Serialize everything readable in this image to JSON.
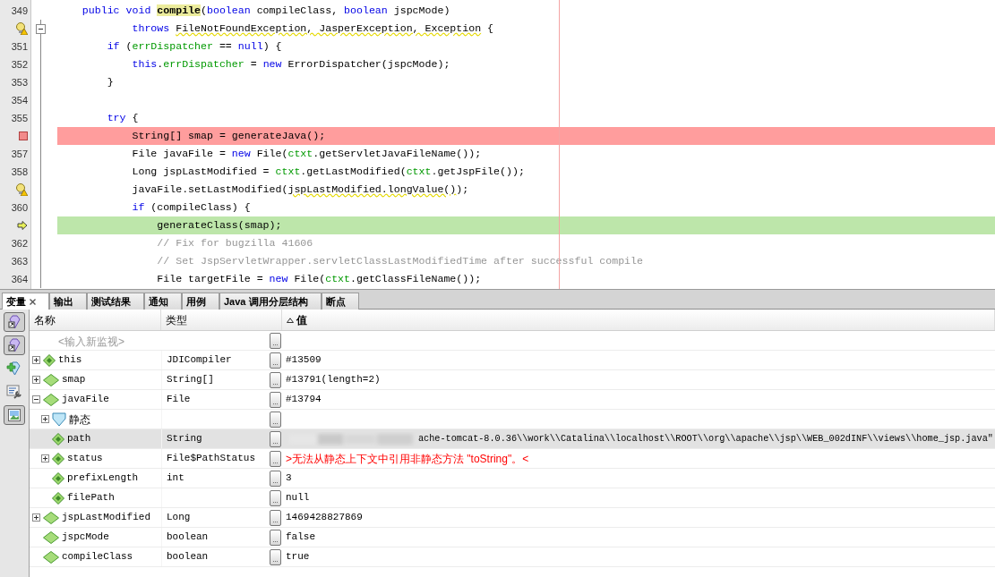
{
  "editor": {
    "lines": [
      {
        "number": "349",
        "kind": "plain",
        "fold": false,
        "tokens": [
          {
            "kind": "keyword",
            "text": "    public void "
          },
          {
            "kind": "match",
            "text": "compile"
          },
          {
            "kind": "plain",
            "text": "("
          },
          {
            "kind": "keyword",
            "text": "boolean"
          },
          {
            "kind": "plain",
            "text": " compileClass, "
          },
          {
            "kind": "keyword",
            "text": "boolean"
          },
          {
            "kind": "plain",
            "text": " jspcMode)"
          }
        ]
      },
      {
        "kind": "warning",
        "fold": true,
        "tokens": [
          {
            "kind": "keyword",
            "text": "            throws "
          },
          {
            "kind": "warn",
            "text": "FileNotFoundException, JasperException, Exception"
          },
          {
            "kind": "plain",
            "text": " {"
          }
        ]
      },
      {
        "number": "351",
        "kind": "plain",
        "fold": false,
        "tokens": [
          {
            "kind": "keyword",
            "text": "        if"
          },
          {
            "kind": "plain",
            "text": " ("
          },
          {
            "kind": "field",
            "text": "errDispatcher"
          },
          {
            "kind": "plain",
            "text": " == "
          },
          {
            "kind": "keyword",
            "text": "null"
          },
          {
            "kind": "plain",
            "text": ") {"
          }
        ]
      },
      {
        "number": "352",
        "kind": "plain",
        "fold": false,
        "tokens": [
          {
            "kind": "keyword",
            "text": "            this"
          },
          {
            "kind": "plain",
            "text": "."
          },
          {
            "kind": "field",
            "text": "errDispatcher"
          },
          {
            "kind": "plain",
            "text": " = "
          },
          {
            "kind": "keyword",
            "text": "new"
          },
          {
            "kind": "plain",
            "text": " ErrorDispatcher(jspcMode);"
          }
        ]
      },
      {
        "number": "353",
        "kind": "plain",
        "fold": false,
        "tokens": [
          {
            "kind": "plain",
            "text": "        }"
          }
        ]
      },
      {
        "number": "354",
        "kind": "plain",
        "fold": false
      },
      {
        "number": "355",
        "kind": "plain",
        "fold": false,
        "tokens": [
          {
            "kind": "keyword",
            "text": "        try"
          },
          {
            "kind": "plain",
            "text": " {"
          }
        ]
      },
      {
        "kind": "breakpoint",
        "fold": false,
        "tokens": [
          {
            "kind": "plain",
            "text": "            String[] smap = generateJava();"
          }
        ]
      },
      {
        "number": "357",
        "kind": "plain",
        "fold": false,
        "tokens": [
          {
            "kind": "plain",
            "text": "            File javaFile = "
          },
          {
            "kind": "keyword",
            "text": "new"
          },
          {
            "kind": "plain",
            "text": " File("
          },
          {
            "kind": "field",
            "text": "ctxt"
          },
          {
            "kind": "plain",
            "text": ".getServletJavaFileName());"
          }
        ]
      },
      {
        "number": "358",
        "kind": "plain",
        "fold": false,
        "tokens": [
          {
            "kind": "plain",
            "text": "            Long jspLastModified = "
          },
          {
            "kind": "field",
            "text": "ctxt"
          },
          {
            "kind": "plain",
            "text": ".getLastModified("
          },
          {
            "kind": "field",
            "text": "ctxt"
          },
          {
            "kind": "plain",
            "text": ".getJspFile());"
          }
        ]
      },
      {
        "kind": "warning",
        "fold": false,
        "tokens": [
          {
            "kind": "plain",
            "text": "            javaFile.setLastModified("
          },
          {
            "kind": "warn",
            "text": "jspLastModified.longValue()"
          },
          {
            "kind": "plain",
            "text": ");"
          }
        ]
      },
      {
        "number": "360",
        "kind": "plain",
        "fold": false,
        "tokens": [
          {
            "kind": "keyword",
            "text": "            if"
          },
          {
            "kind": "plain",
            "text": " (compileClass) {"
          }
        ]
      },
      {
        "kind": "current",
        "fold": false,
        "tokens": [
          {
            "kind": "plain",
            "text": "                generateClass(smap);"
          }
        ]
      },
      {
        "number": "362",
        "kind": "plain",
        "fold": false,
        "tokens": [
          {
            "kind": "comment",
            "text": "                // Fix for bugzilla 41606"
          }
        ]
      },
      {
        "number": "363",
        "kind": "plain",
        "fold": false,
        "tokens": [
          {
            "kind": "comment",
            "text": "                // Set JspServletWrapper.servletClassLastModifiedTime after successful compile"
          }
        ]
      },
      {
        "number": "364",
        "kind": "plain",
        "fold": false,
        "tokens": [
          {
            "kind": "plain",
            "text": "                File targetFile = "
          },
          {
            "kind": "keyword",
            "text": "new"
          },
          {
            "kind": "plain",
            "text": " File("
          },
          {
            "kind": "field",
            "text": "ctxt"
          },
          {
            "kind": "plain",
            "text": ".getClassFileName());"
          }
        ]
      }
    ]
  },
  "tabs": [
    {
      "label": "变量",
      "selected": true,
      "closable": true
    },
    {
      "label": "输出",
      "selected": false,
      "closable": false
    },
    {
      "label": "测试结果",
      "selected": false,
      "closable": false
    },
    {
      "label": "通知",
      "selected": false,
      "closable": false
    },
    {
      "label": "用例",
      "selected": false,
      "closable": false
    },
    {
      "label": "Java 调用分层结构",
      "selected": false,
      "closable": false
    },
    {
      "label": "断点",
      "selected": false,
      "closable": false
    }
  ],
  "toolbar": [
    {
      "kind": "gem-arrow",
      "pressed": true
    },
    {
      "kind": "gem-arrow",
      "pressed": true
    },
    {
      "kind": "gem-add",
      "pressed": false
    },
    {
      "kind": "wrench",
      "pressed": false
    },
    {
      "kind": "image",
      "pressed": true
    }
  ],
  "table": {
    "columns": [
      {
        "label": "名称",
        "sorted": false
      },
      {
        "label": "类型",
        "sorted": false
      },
      {
        "label": "值",
        "sorted": true
      }
    ],
    "new_watch": {
      "placeholder": "<输入新监视>",
      "edit_button": "..."
    },
    "rows": [
      {
        "name": "this",
        "kind": "field",
        "type": "JDICompiler",
        "value": "#13509",
        "expandable": true,
        "expanded": false,
        "selected": false,
        "error": false,
        "blurred": false,
        "edit_button": "..."
      },
      {
        "name": "smap",
        "kind": "local",
        "type": "String[]",
        "value": "#13791(length=2)",
        "expandable": true,
        "expanded": false,
        "selected": false,
        "error": false,
        "blurred": false,
        "edit_button": "..."
      },
      {
        "name": "javaFile",
        "kind": "local",
        "type": "File",
        "value": "#13794",
        "expandable": true,
        "expanded": true,
        "selected": false,
        "error": false,
        "blurred": false,
        "edit_button": "...",
        "children": [
          {
            "name": "静态",
            "kind": "static",
            "expandable": true,
            "expanded": false,
            "selected": false,
            "edit_button": "..."
          },
          {
            "name": "path",
            "kind": "field",
            "type": "String",
            "value": "ache-tomcat-8.0.36\\\\work\\\\Catalina\\\\localhost\\\\ROOT\\\\org\\\\apache\\\\jsp\\\\WEB_002dINF\\\\views\\\\home_jsp.java\"",
            "expandable": false,
            "selected": true,
            "error": false,
            "blurred": true,
            "edit_button": "..."
          },
          {
            "name": "status",
            "kind": "field",
            "type": "File$PathStatus",
            "value": ">无法从静态上下文中引用非静态方法 \"toString\"。<",
            "expandable": true,
            "expanded": false,
            "selected": false,
            "error": true,
            "blurred": false,
            "edit_button": "..."
          },
          {
            "name": "prefixLength",
            "kind": "field",
            "type": "int",
            "value": "3",
            "expandable": false,
            "selected": false,
            "error": false,
            "blurred": false,
            "edit_button": "..."
          },
          {
            "name": "filePath",
            "kind": "field",
            "value": "null",
            "expandable": false,
            "selected": false,
            "error": false,
            "blurred": false,
            "edit_button": "..."
          }
        ]
      },
      {
        "name": "jspLastModified",
        "kind": "local",
        "type": "Long",
        "value": "1469428827869",
        "expandable": true,
        "expanded": false,
        "selected": false,
        "error": false,
        "blurred": false,
        "edit_button": "..."
      },
      {
        "name": "jspcMode",
        "kind": "local",
        "type": "boolean",
        "value": "false",
        "expandable": false,
        "selected": false,
        "error": false,
        "blurred": false,
        "edit_button": "..."
      },
      {
        "name": "compileClass",
        "kind": "local",
        "type": "boolean",
        "value": "true",
        "expandable": false,
        "selected": false,
        "error": false,
        "blurred": false,
        "edit_button": "..."
      }
    ]
  }
}
